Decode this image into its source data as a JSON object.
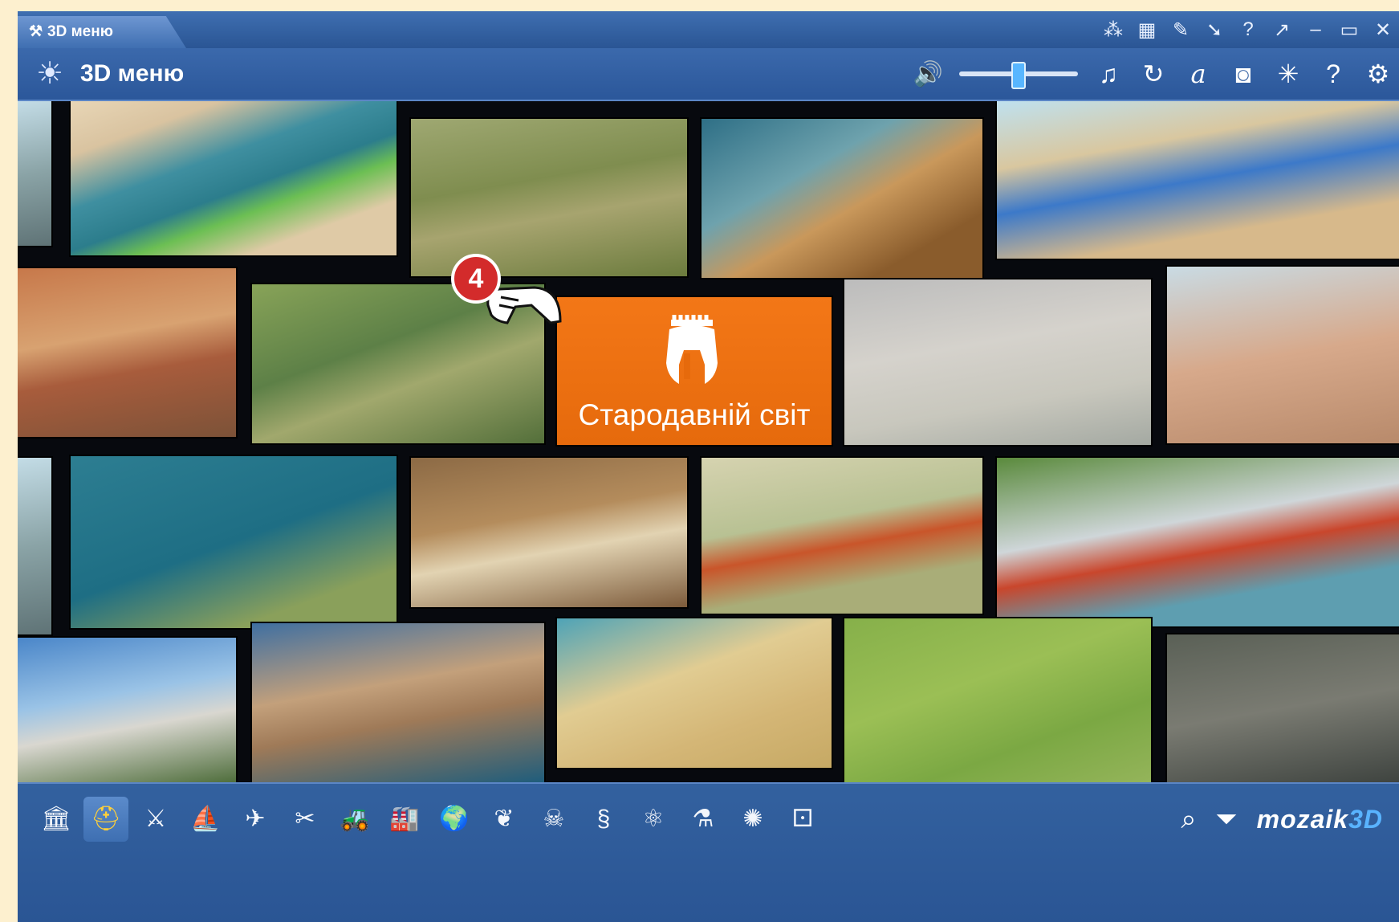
{
  "window": {
    "tab_title": "3D меню",
    "titlebar_icons": [
      "network-icon",
      "gallery-icon",
      "pencil-icon",
      "pointer-icon",
      "help-icon",
      "external-icon",
      "minimize-icon",
      "maximize-icon",
      "close-icon"
    ]
  },
  "menubar": {
    "title": "3D меню",
    "volume": 0.5,
    "tools": [
      "music-icon",
      "rotate-icon",
      "font-icon",
      "camera-icon",
      "sparkle-icon",
      "help-icon",
      "gear-icon"
    ]
  },
  "featured": {
    "title": "Стародавній світ"
  },
  "pointer": {
    "step": "4"
  },
  "bottombar": {
    "categories": [
      "history-column-icon",
      "ancient-helmet-icon",
      "medieval-icon",
      "sailing-ship-icon",
      "airplane-icon",
      "modern-icon",
      "vehicle-icon",
      "factory-icon",
      "globe-icon",
      "plant-icon",
      "skull-icon",
      "dna-icon",
      "molecule-icon",
      "flask-icon",
      "atom-icon",
      "dice-icon"
    ],
    "active_category": 1,
    "brand_prefix": "mozaik",
    "brand_suffix": "3D"
  },
  "colors": {
    "frame_blue": "#2b579a",
    "featured_orange": "#f37717",
    "speaker_green": "#3fd23a",
    "badge_red": "#d32b2b"
  }
}
